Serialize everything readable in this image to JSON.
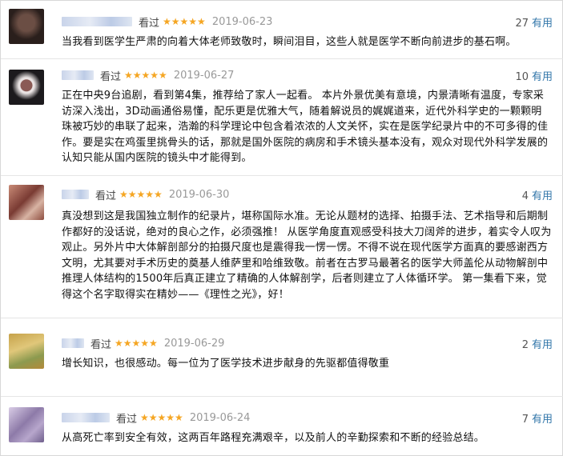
{
  "reviews": [
    {
      "watched": "看过",
      "rating": 5,
      "stars": "★★★★★",
      "date": "2019-06-23",
      "votes": "27",
      "useful_label": "有用",
      "text": "当我看到医学生严肃的向着大体老师致敬时，瞬间泪目，这些人就是医学不断向前进步的基石啊。",
      "avatar_colors": [
        "#2a1f1c",
        "#6b4e44"
      ]
    },
    {
      "watched": "看过",
      "rating": 5,
      "stars": "★★★★★",
      "date": "2019-06-27",
      "votes": "10",
      "useful_label": "有用",
      "text": "正在中央9台追剧，看到第4集，推荐给了家人一起看。 本片外景优美有意境，内景清晰有温度，专家采访深入浅出，3D动画通俗易懂，配乐更是优雅大气，随着解说员的娓娓道来，近代外科学史的一颗颗明珠被巧妙的串联了起来，浩瀚的科学理论中包含着浓浓的人文关怀，实在是医学纪录片中的不可多得的佳作。要是实在鸡蛋里挑骨头的话，那就是国外医院的病房和手术镜头基本没有，观众对现代外科学发展的认知只能从国内医院的镜头中才能得到。",
      "avatar_colors": [
        "#1c1a1d",
        "#8a5a55"
      ]
    },
    {
      "watched": "看过",
      "rating": 5,
      "stars": "★★★★★",
      "date": "2019-06-30",
      "votes": "4",
      "useful_label": "有用",
      "text": "真没想到这是我国独立制作的纪录片，堪称国际水准。无论从题材的选择、拍摄手法、艺术指导和后期制作都好的没话说，绝对的良心之作，必须强推！ 从医学角度直观感受科技大刀阔斧的进步，着实令人叹为观止。另外片中大体解剖部分的拍摄尺度也是震得我一愣一愣。不得不说在现代医学方面真的要感谢西方文明，尤其要对手术历史的奠基人维萨里和哈维致敬。前者在古罗马最著名的医学大师盖伦从动物解剖中推理人体结构的1500年后真正建立了精确的人体解剖学，后者则建立了人体循环学。 第一集看下来，觉得这个名字取得实在精妙——《理性之光》，好！",
      "avatar_colors": [
        "#7a3b33",
        "#c98b77"
      ]
    },
    {
      "watched": "看过",
      "rating": 5,
      "stars": "★★★★★",
      "date": "2019-06-29",
      "votes": "2",
      "useful_label": "有用",
      "text": "增长知识，也很感动。每一位为了医学技术进步献身的先驱都值得敬重",
      "avatar_colors": [
        "#c6a24a",
        "#8c9a4f"
      ]
    },
    {
      "watched": "看过",
      "rating": 5,
      "stars": "★★★★★",
      "date": "2019-06-24",
      "votes": "7",
      "useful_label": "有用",
      "text": "从高死亡率到安全有效，这两百年路程充满艰辛，以及前人的辛勤探索和不断的经验总结。",
      "avatar_colors": [
        "#8d7aa8",
        "#d9cde6"
      ]
    }
  ]
}
